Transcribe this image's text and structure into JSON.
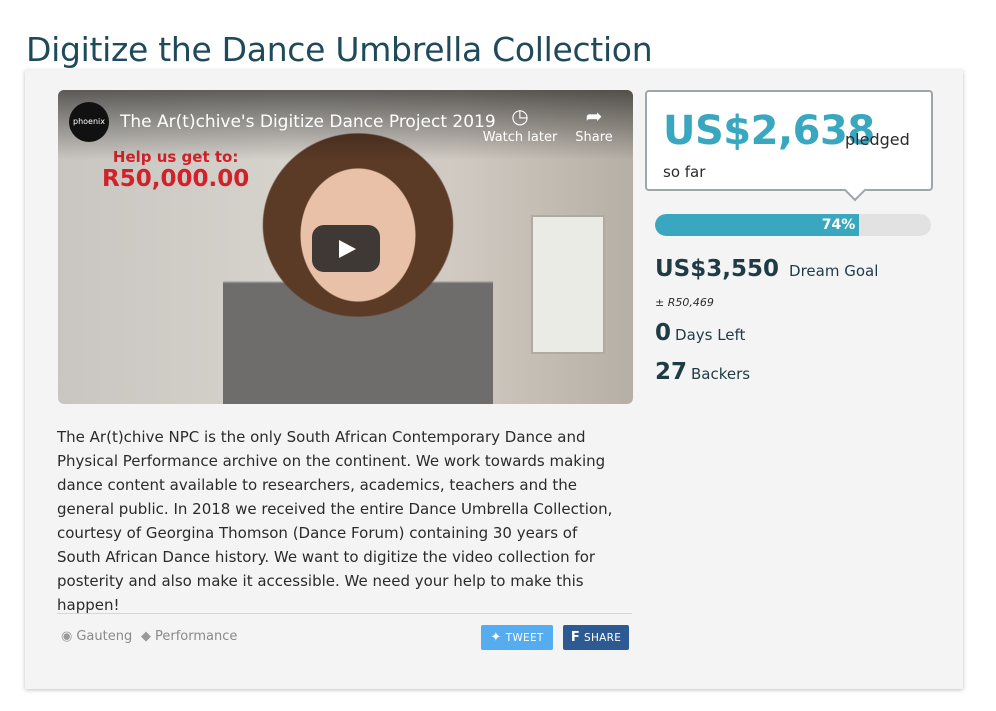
{
  "page": {
    "title": "Digitize the Dance Umbrella Collection"
  },
  "video": {
    "channel_logo": "phoenix",
    "title": "The Ar(t)chive's Digitize Dance Project 2019",
    "watch_later_label": "Watch later",
    "share_label": "Share",
    "overlay_line1": "Help us get to:",
    "overlay_line2": "R50,000.00"
  },
  "description": "The Ar(t)chive NPC is the only South African Contemporary Dance and Physical Performance archive on the continent. We work towards making dance content available to researchers, academics, teachers and the general public. In 2018 we received the entire Dance Umbrella Collection, courtesy of Georgina Thomson (Dance Forum) containing 30 years of South African Dance history. We want to digitize the video collection for posterity and also make it accessible. We need your help to make this happen!",
  "tags": {
    "location": "Gauteng",
    "category": "Performance"
  },
  "buttons": {
    "tweet": "Tweet",
    "share": "Share"
  },
  "funding": {
    "pledged": "US$2,638",
    "pledged_label": "pledged",
    "so_far_label": "so far",
    "progress_percent": 74,
    "progress_text": "74%",
    "goal": "US$3,550",
    "goal_label": "Dream Goal",
    "goal_zar": "± R50,469",
    "days_left": "0",
    "days_left_label": "Days Left",
    "backers": "27",
    "backers_label": "Backers"
  },
  "colors": {
    "accent": "#3aa7c1",
    "twitter": "#55acee",
    "facebook": "#2d5a92",
    "title": "#1f4a5a"
  }
}
